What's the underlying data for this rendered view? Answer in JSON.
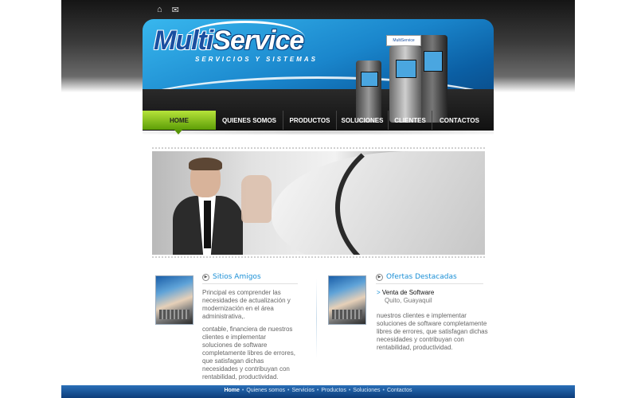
{
  "top_icons": {
    "home": "⌂",
    "mail": "✉"
  },
  "logo": {
    "name_part1": "Multi",
    "name_part2": "Service",
    "tagline": "SERVICIOS Y SISTEMAS",
    "atm_sign": "MultiService"
  },
  "nav": {
    "home": "HOME",
    "items": [
      "QUIENES SOMOS",
      "PRODUCTOS",
      "SOLUCIONES",
      "CLIENTES",
      "CONTACTOS"
    ]
  },
  "left_col": {
    "title": "Sitios Amigos",
    "para1": "Principal es comprender las necesidades de actualización y modernización en el área administrativa,.",
    "para2": "contable, financiera de nuestros clientes e implementar soluciones de software completamente libres de errores, que satisfagan dichas necesidades y contribuyan con rentabilidad, productividad."
  },
  "right_col": {
    "title": "Ofertas Destacadas",
    "offer_marker": ">",
    "offer_title": "Venta de Software",
    "offer_city": "Quito, Guayaquil",
    "para": "nuestros clientes e implementar soluciones de software completamente libres de errores, que satisfagan dichas necesidades y contribuyan con rentabilidad, productividad."
  },
  "footer": {
    "links": [
      "Home",
      "Quienes somos",
      "Servicios",
      "Productos",
      "Soluciones",
      "Contactos"
    ],
    "separator": "•"
  },
  "colors": {
    "accent_green": "#8cc820",
    "accent_blue": "#1a8fd6",
    "footer_blue": "#0d3d7a"
  }
}
